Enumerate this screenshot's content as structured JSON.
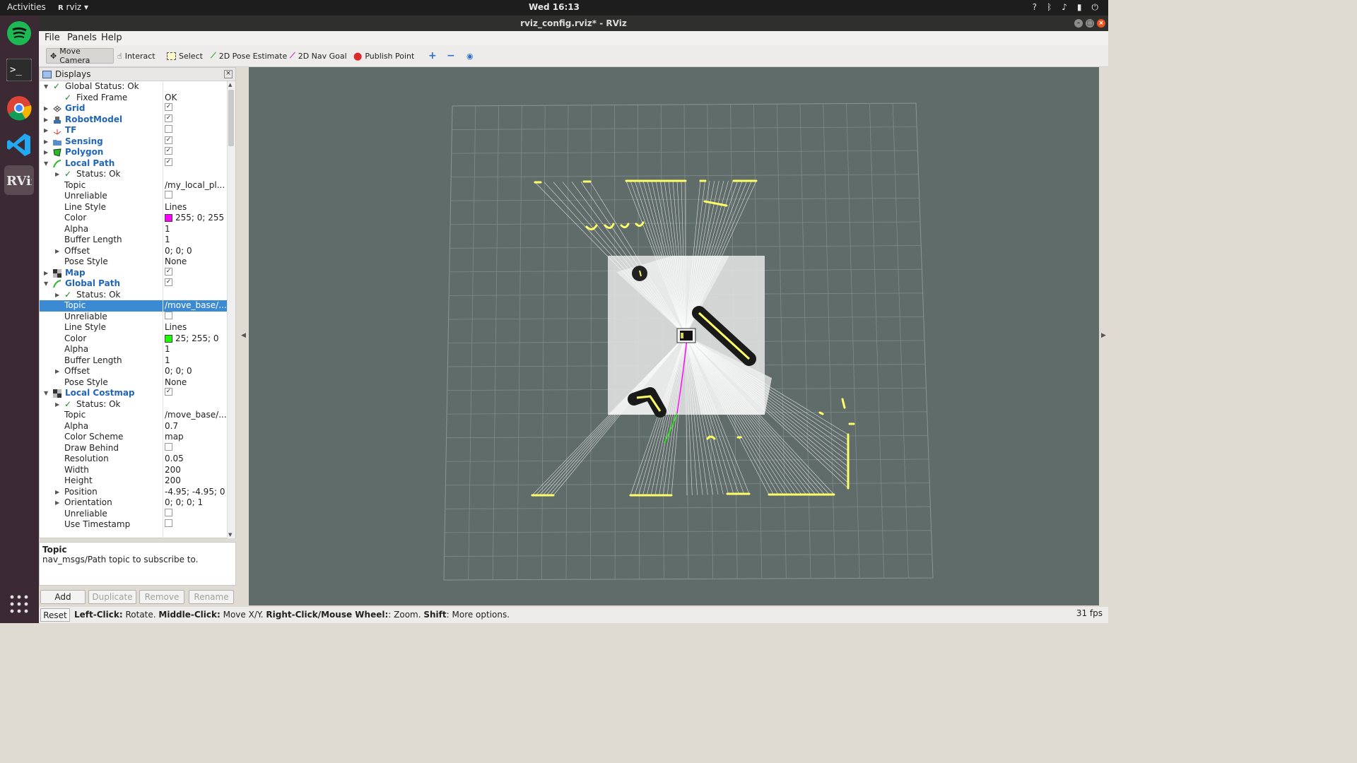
{
  "system": {
    "activities": "Activities",
    "app_menu": "rviz",
    "clock": "Wed 16:13"
  },
  "window": {
    "title": "rviz_config.rviz* - RViz"
  },
  "menu": {
    "file": "File",
    "panels": "Panels",
    "help": "Help"
  },
  "toolbar": {
    "move_camera": "Move Camera",
    "interact": "Interact",
    "select": "Select",
    "pose_estimate": "2D Pose Estimate",
    "nav_goal": "2D Nav Goal",
    "publish_point": "Publish Point"
  },
  "displays": {
    "title": "Displays",
    "rows": [
      {
        "name": "Global Status: Ok",
        "value": "",
        "check": true
      },
      {
        "name": "Fixed Frame",
        "value": "OK",
        "check": true
      },
      {
        "name": "Grid",
        "value": "✓"
      },
      {
        "name": "RobotModel",
        "value": "✓"
      },
      {
        "name": "TF",
        "value": ""
      },
      {
        "name": "Sensing",
        "value": "✓"
      },
      {
        "name": "Polygon",
        "value": "✓"
      },
      {
        "name": "Local Path",
        "value": "✓"
      },
      {
        "name": "Status: Ok",
        "value": "",
        "check": true
      },
      {
        "name": "Topic",
        "value": "/my_local_pl..."
      },
      {
        "name": "Unreliable",
        "value": ""
      },
      {
        "name": "Line Style",
        "value": "Lines"
      },
      {
        "name": "Color",
        "value": "255; 0; 255",
        "color": "#ff00ff"
      },
      {
        "name": "Alpha",
        "value": "1"
      },
      {
        "name": "Buffer Length",
        "value": "1"
      },
      {
        "name": "Offset",
        "value": "0; 0; 0"
      },
      {
        "name": "Pose Style",
        "value": "None"
      },
      {
        "name": "Map",
        "value": "✓"
      },
      {
        "name": "Global Path",
        "value": "✓"
      },
      {
        "name": "Status: Ok",
        "value": "",
        "check": true
      },
      {
        "name": "Topic",
        "value": "/move_base/..."
      },
      {
        "name": "Unreliable",
        "value": ""
      },
      {
        "name": "Line Style",
        "value": "Lines"
      },
      {
        "name": "Color",
        "value": "25; 255; 0",
        "color": "#19ff00"
      },
      {
        "name": "Alpha",
        "value": "1"
      },
      {
        "name": "Buffer Length",
        "value": "1"
      },
      {
        "name": "Offset",
        "value": "0; 0; 0"
      },
      {
        "name": "Pose Style",
        "value": "None"
      },
      {
        "name": "Local Costmap",
        "value": "✓"
      },
      {
        "name": "Status: Ok",
        "value": "",
        "check": true
      },
      {
        "name": "Topic",
        "value": "/move_base/..."
      },
      {
        "name": "Alpha",
        "value": "0.7"
      },
      {
        "name": "Color Scheme",
        "value": "map"
      },
      {
        "name": "Draw Behind",
        "value": ""
      },
      {
        "name": "Resolution",
        "value": "0.05"
      },
      {
        "name": "Width",
        "value": "200"
      },
      {
        "name": "Height",
        "value": "200"
      },
      {
        "name": "Position",
        "value": "-4.95; -4.95; 0"
      },
      {
        "name": "Orientation",
        "value": "0; 0; 0; 1"
      },
      {
        "name": "Unreliable",
        "value": ""
      },
      {
        "name": "Use Timestamp",
        "value": ""
      }
    ]
  },
  "description": {
    "title": "Topic",
    "text": "nav_msgs/Path topic to subscribe to."
  },
  "buttons": {
    "add": "Add",
    "duplicate": "Duplicate",
    "remove": "Remove",
    "rename": "Rename"
  },
  "status": {
    "reset": "Reset",
    "hint_parts": [
      "Left-Click:",
      " Rotate. ",
      "Middle-Click:",
      " Move X/Y. ",
      "Right-Click/Mouse Wheel:",
      ": Zoom. ",
      "Shift",
      ": More options."
    ],
    "fps": "31 fps"
  },
  "colors": {
    "viewport_bg": "#606c6a",
    "local_path": "#ff00ff",
    "global_path": "#19ff00",
    "laser": "#ffff66",
    "selection": "#3d8ad4"
  }
}
